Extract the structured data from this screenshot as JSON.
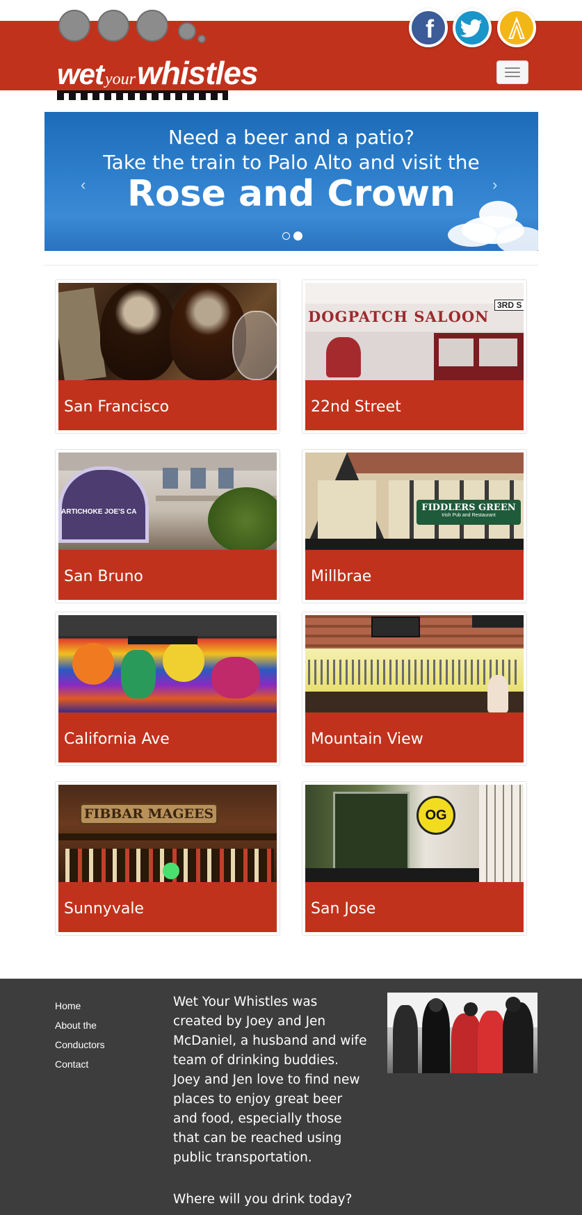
{
  "header": {
    "logo_word1": "wet",
    "logo_word2": "your",
    "logo_word3": "whistles",
    "social": [
      {
        "name": "facebook",
        "glyph": "f",
        "color": "#3b5b99"
      },
      {
        "name": "twitter",
        "glyph": "twitter-bird",
        "color": "#1a95c8"
      },
      {
        "name": "yelp-untappd",
        "glyph": "A",
        "color": "#f3b617"
      }
    ],
    "accent_color": "#c1321c"
  },
  "carousel": {
    "line1": "Need a beer and a patio?",
    "line2": "Take the train to Palo Alto and visit the",
    "title": "Rose and Crown",
    "prev_glyph": "‹",
    "next_glyph": "›",
    "slide_count": 2,
    "active_slide": 2
  },
  "tiles": [
    {
      "label": "San Francisco"
    },
    {
      "label": "22nd Street"
    },
    {
      "label": "San Bruno"
    },
    {
      "label": "Millbrae"
    },
    {
      "label": "California Ave"
    },
    {
      "label": "Mountain View"
    },
    {
      "label": "Sunnyvale"
    },
    {
      "label": "San Jose"
    }
  ],
  "photo_signage": {
    "dogpatch": "DOGPATCH SALOON",
    "third_street": "3RD S",
    "artichoke": "ARTICHOKE JOE'S CA",
    "fiddlers": "FIDDLERS GREEN",
    "fiddlers_sub": "Irish Pub and Restaurant",
    "fibbar": "FIBBAR MAGEES",
    "og": "OG"
  },
  "footer": {
    "nav": [
      "Home",
      "About the Conductors",
      "Contact"
    ],
    "about": "Wet Your Whistles was created by Joey and Jen McDaniel, a husband and wife team of drinking buddies. Joey and Jen love to find new places to enjoy great beer and food, especially those that can be reached using public transportation.",
    "tagline": "Where will you drink today?",
    "background": "#3d3d3d"
  }
}
